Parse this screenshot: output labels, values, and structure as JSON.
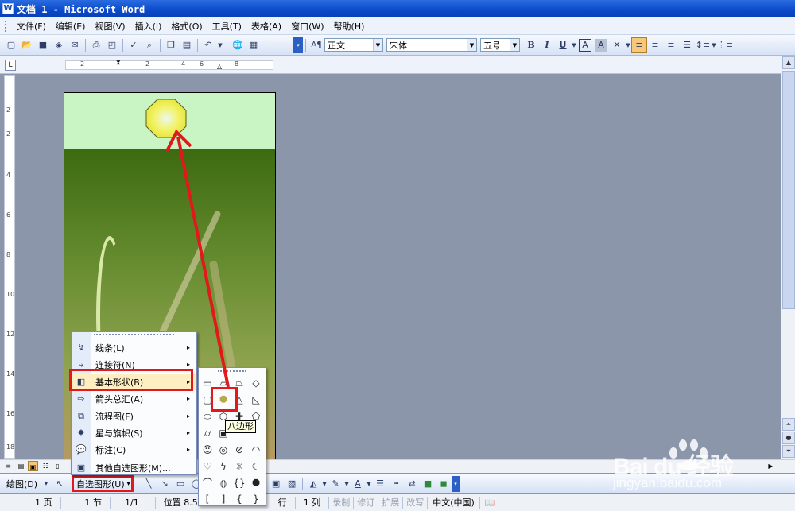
{
  "title": "文档 1 - Microsoft Word",
  "menu": [
    "文件(F)",
    "编辑(E)",
    "视图(V)",
    "插入(I)",
    "格式(O)",
    "工具(T)",
    "表格(A)",
    "窗口(W)",
    "帮助(H)"
  ],
  "toolbar": {
    "style": "正文",
    "font": "宋体",
    "size": "五号",
    "bold": "B",
    "italic": "I",
    "underline": "U",
    "char_border": "A",
    "char_shade": "A"
  },
  "ruler": {
    "h_labels": [
      "2",
      "2",
      "4",
      "6",
      "8"
    ],
    "v_labels": [
      "2",
      "2",
      "4",
      "6",
      "8",
      "10",
      "12",
      "14",
      "16",
      "18"
    ]
  },
  "shape_menu": {
    "items": [
      {
        "label": "线条(L)",
        "has_submenu": true
      },
      {
        "label": "连接符(N)",
        "has_submenu": true
      },
      {
        "label": "基本形状(B)",
        "has_submenu": true
      },
      {
        "label": "箭头总汇(A)",
        "has_submenu": true
      },
      {
        "label": "流程图(F)",
        "has_submenu": true
      },
      {
        "label": "星与旗帜(S)",
        "has_submenu": true
      },
      {
        "label": "标注(C)",
        "has_submenu": true
      },
      {
        "label": "其他自选图形(M)...",
        "has_submenu": false
      }
    ],
    "arrow": "▸"
  },
  "palette": {
    "tooltip": "八边形"
  },
  "drawbar": {
    "draw": "绘图(D)",
    "autoshapes": "自选图形(U)"
  },
  "status": {
    "page": "1 页",
    "section": "1 节",
    "page_of": "1/1",
    "position": "位置 8.5厘",
    "line": "行",
    "col": "1 列",
    "rec": "录制",
    "trk": "修订",
    "ext": "扩展",
    "ovr": "改写",
    "lang": "中文(中国)"
  },
  "watermark": {
    "brand": "Bai du 经验",
    "url": "jingyan.baidu.com"
  },
  "colors": {
    "highlight": "#e1191b",
    "octagon_fill": "#f3f36a",
    "title_bar": "#0a49c9"
  }
}
